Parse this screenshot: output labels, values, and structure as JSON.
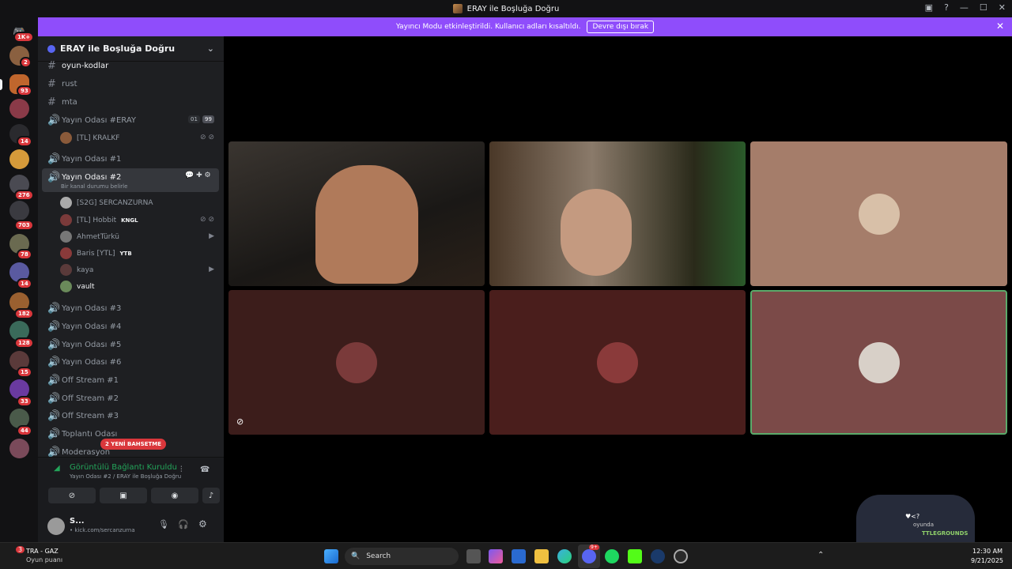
{
  "window": {
    "title": "ERAY ile Boşluğa Doğru"
  },
  "banner": {
    "text": "Yayıncı Modu etkinleştirildi. Kullanıcı adları kısaltıldı.",
    "button": "Devre dışı bırak"
  },
  "rail": {
    "badges": [
      "1K+",
      "2",
      "93",
      "14",
      "276",
      "703",
      "78",
      "14",
      "182",
      "128",
      "15",
      "33",
      "44"
    ]
  },
  "server": {
    "name": "ERAY ile Boşluğa Doğru"
  },
  "channels": {
    "oyun": "oyun-kodlar",
    "rust": "rust",
    "mta": "mta",
    "eray": "Yayın Odası #ERAY",
    "eray_count1": "01",
    "eray_count2": "99",
    "eray_user": "[TL] KRALKF",
    "oda1": "Yayın Odası #1",
    "oda2": "Yayın Odası #2",
    "oda2_status": "Bir kanal durumu belirle",
    "users": [
      "[S2G] SERCANZURNA",
      "[TL] Hobbit",
      "AhmetTürkü",
      "Baris [YTL]",
      "kaya",
      "vault"
    ],
    "tag_hobbit": "KNGL",
    "tag_baris": "YTB",
    "rest": [
      "Yayın Odası #3",
      "Yayın Odası #4",
      "Yayın Odası #5",
      "Yayın Odası #6",
      "Off Stream #1",
      "Off Stream #2",
      "Off Stream #3",
      "Toplantı Odası",
      "Moderasyon"
    ],
    "mention": "2 YENİ BAHSETME"
  },
  "voice": {
    "status": "Görüntülü Bağlantı Kuruldu",
    "location": "Yayın Odası #2 / ERAY ile Boşluğa Doğru"
  },
  "user": {
    "name": "S...",
    "status": "• kick.com/sercanzurna"
  },
  "taskbar": {
    "weather_title": "TRA - GAZ",
    "weather_sub": "Oyun puanı",
    "search": "Search",
    "time": "12:30 AM",
    "date": "9/21/2025",
    "notif_badge": "3",
    "discord_badge": "9+"
  },
  "overlay": {
    "line1": "♥<?",
    "line2": "oyunda",
    "line3": "TTLEGROUNDS"
  }
}
